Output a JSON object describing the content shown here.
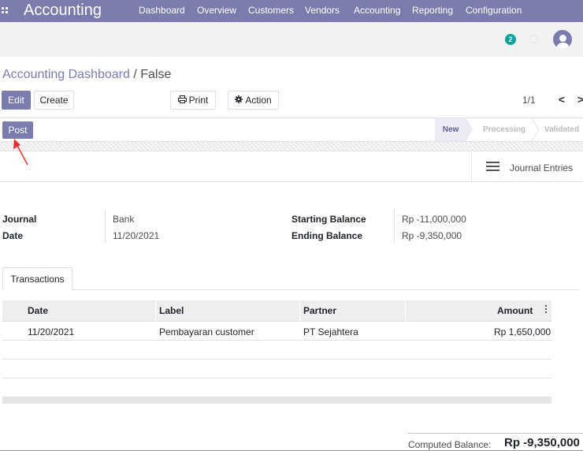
{
  "navbar": {
    "brand": "Accounting",
    "menu": [
      "Dashboard",
      "Overview",
      "Customers",
      "Vendors",
      "Accounting",
      "Reporting",
      "Configuration"
    ]
  },
  "systray": {
    "message_count": "2"
  },
  "breadcrumb": {
    "parent": "Accounting Dashboard",
    "separator": " / ",
    "current": "False"
  },
  "control": {
    "edit_label": "Edit",
    "create_label": "Create",
    "print_label": "Print",
    "action_label": "Action",
    "pager_value": "1/1",
    "pager_prev": "<",
    "pager_next": ">"
  },
  "statusbar": {
    "post_label": "Post",
    "stages": [
      "New",
      "Processing",
      "Validated"
    ],
    "active_stage": "New"
  },
  "smart_button": {
    "journal_entries_label": "Journal Entries"
  },
  "form": {
    "journal_label": "Journal",
    "journal_value": "Bank",
    "date_label": "Date",
    "date_value": "11/20/2021",
    "starting_balance_label": "Starting Balance",
    "starting_balance_value": "Rp -11,000,000",
    "ending_balance_label": "Ending Balance",
    "ending_balance_value": "Rp -9,350,000"
  },
  "tabs": {
    "transactions": "Transactions"
  },
  "table": {
    "headers": {
      "date": "Date",
      "label": "Label",
      "partner": "Partner",
      "amount": "Amount"
    },
    "rows": [
      {
        "date": "11/20/2021",
        "label": "Pembayaran customer",
        "partner": "PT Sejahtera",
        "amount": "Rp 1,650,000"
      }
    ]
  },
  "footer": {
    "computed_label": "Computed Balance:",
    "computed_value": "Rp -9,350,000"
  },
  "colors": {
    "brand": "#7c7bad",
    "badge": "#00a09d",
    "annotation": "#e8312f"
  }
}
